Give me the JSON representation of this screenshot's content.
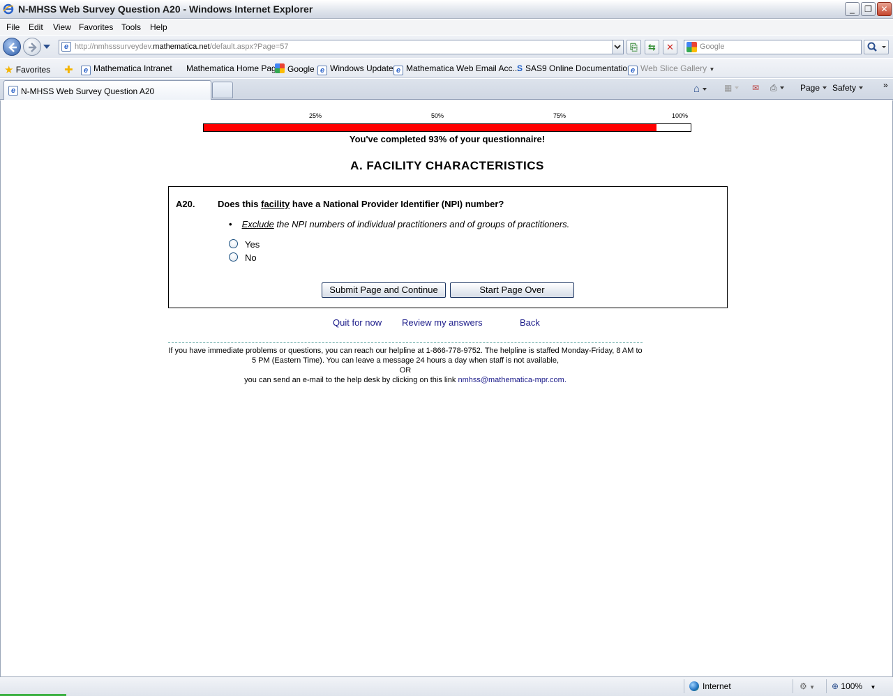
{
  "window": {
    "title": "N-MHSS Web Survey Question A20 - Windows Internet Explorer"
  },
  "menu": {
    "items": [
      "File",
      "Edit",
      "View",
      "Favorites",
      "Tools",
      "Help"
    ]
  },
  "address": {
    "url_prefix": "http://nmhsssurveydev.",
    "url_domain": "mathematica.net",
    "url_suffix": "/default.aspx?Page=57"
  },
  "search": {
    "placeholder": "Google"
  },
  "favorites_bar": {
    "favorites_label": "Favorites",
    "links": [
      "Mathematica Intranet",
      "Mathematica Home Page",
      "Google",
      "Windows Update",
      "Mathematica Web Email Acc...",
      "SAS9 Online Documentation",
      "Web Slice Gallery"
    ]
  },
  "tabs": {
    "active_title": "N-MHSS Web Survey Question A20"
  },
  "command_bar": {
    "page_label": "Page",
    "safety_label": "Safety"
  },
  "progress": {
    "ticks": [
      "25%",
      "50%",
      "75%",
      "100%"
    ],
    "percent_complete": 93,
    "message": "You've completed 93% of your questionnaire!",
    "fill_color": "#ff0000"
  },
  "section": {
    "title": "A. FACILITY CHARACTERISTICS"
  },
  "question": {
    "number": "A20.",
    "text_before": "Does this ",
    "text_underlined": "facility",
    "text_after": " have a National Provider Identifier (NPI) number?",
    "bullet_underlined": "Exclude",
    "bullet_rest": " the NPI numbers of individual practitioners and of groups of practitioners.",
    "options": [
      "Yes",
      "No"
    ]
  },
  "buttons": {
    "submit": "Submit Page and Continue",
    "start_over": "Start Page Over"
  },
  "links": {
    "quit": "Quit for now",
    "review": "Review my answers",
    "back": "Back"
  },
  "help": {
    "line1": "If you have immediate problems or questions, you can reach our helpline at 1-866-778-9752. The helpline is staffed Monday-Friday, 8 AM to 5 PM (Eastern Time). You can leave a message 24 hours a day when staff is not available,",
    "or": "OR",
    "line3_prefix": "you can send an e-mail to the help desk by clicking on this link ",
    "email": "nmhss@mathematica-mpr.com."
  },
  "status_bar": {
    "zone": "Internet",
    "zoom": "100%"
  }
}
